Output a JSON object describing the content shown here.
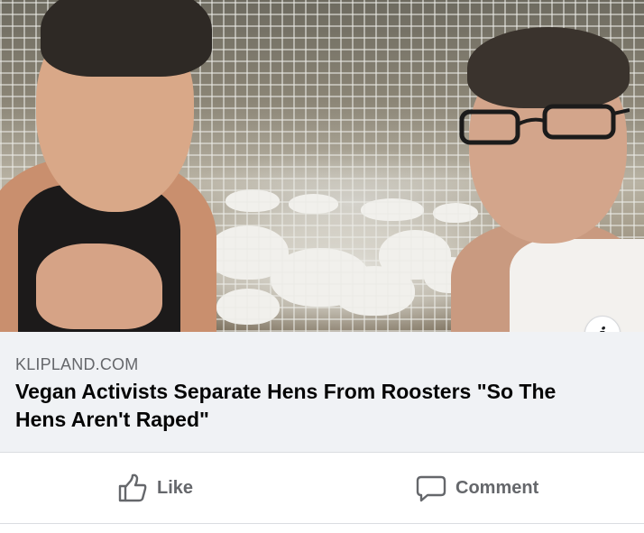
{
  "link_preview": {
    "domain": "KLIPLAND.COM",
    "headline": "Vegan Activists Separate Hens From Roosters \"So The Hens Aren't Raped\"",
    "info_icon": "i"
  },
  "actions": {
    "like_label": "Like",
    "comment_label": "Comment",
    "like_icon": "thumbs-up-icon",
    "comment_icon": "speech-bubble-icon"
  },
  "colors": {
    "preview_background": "#f0f2f5",
    "secondary_text": "#65676b",
    "headline_text": "#050505"
  }
}
